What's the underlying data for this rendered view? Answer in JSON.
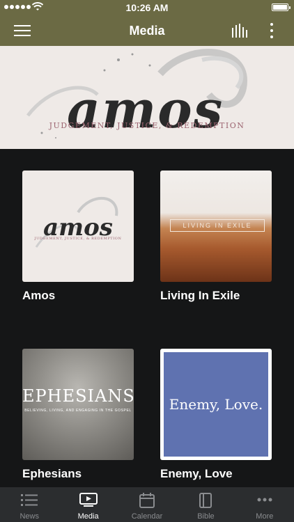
{
  "status": {
    "time": "10:26 AM"
  },
  "header": {
    "title": "Media"
  },
  "banner": {
    "word": "amos",
    "subtitle": "JUDGEMENT, JUSTICE, & REDEMPTION"
  },
  "series": [
    {
      "title": "Amos",
      "art_word": "amos",
      "art_sub": "JUDGEMENT, JUSTICE, & REDEMPTION"
    },
    {
      "title": "Living In Exile",
      "art_word": "LIVING IN EXILE"
    },
    {
      "title": "Ephesians",
      "art_word": "EPHESIANS",
      "art_sub": "BELIEVING, LIVING, AND ENGAGING IN THE GOSPEL"
    },
    {
      "title": "Enemy, Love",
      "art_word": "Enemy, Love."
    }
  ],
  "tabs": [
    {
      "label": "News",
      "icon": "list-icon"
    },
    {
      "label": "Media",
      "icon": "play-icon"
    },
    {
      "label": "Calendar",
      "icon": "calendar-icon"
    },
    {
      "label": "Bible",
      "icon": "book-icon"
    },
    {
      "label": "More",
      "icon": "more-icon"
    }
  ],
  "colors": {
    "nav_bg": "#6b6a44",
    "tabbar_bg": "#2b2d2f",
    "content_bg": "#151617",
    "accent_rose": "#9c6470",
    "enemy_blue": "#5f72b0"
  }
}
